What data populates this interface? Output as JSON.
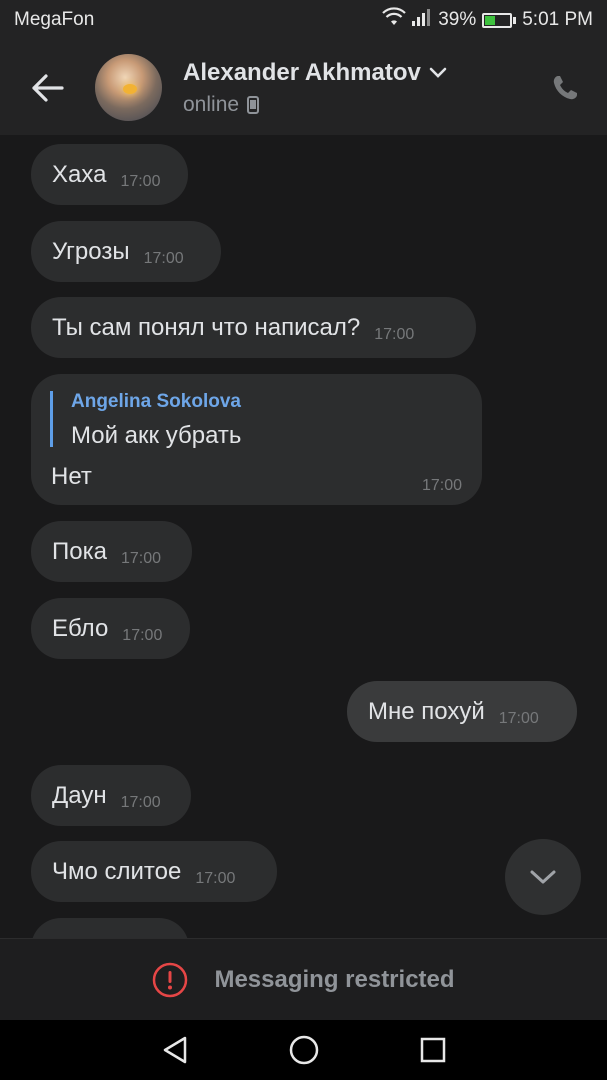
{
  "status_bar": {
    "carrier": "MegaFon",
    "battery": "39%",
    "battery_level": 0.39,
    "time": "5:01 PM"
  },
  "header": {
    "contact_name": "Alexander Akhmatov",
    "status": "online"
  },
  "messages": [
    {
      "text": "Хаха",
      "time": "17:00",
      "direction": "in"
    },
    {
      "text": "Угрозы",
      "time": "17:00",
      "direction": "in"
    },
    {
      "text": "Ты сам понял что написал?",
      "time": "17:00",
      "direction": "in"
    },
    {
      "text": "Нет",
      "time": "17:00",
      "direction": "in",
      "reply_to": {
        "author": "Angelina Sokolova",
        "text": "Мой акк убрать"
      }
    },
    {
      "text": "Пока",
      "time": "17:00",
      "direction": "in"
    },
    {
      "text": "Ебло",
      "time": "17:00",
      "direction": "in"
    },
    {
      "text": "Мне похуй",
      "time": "17:00",
      "direction": "out"
    },
    {
      "text": "Даун",
      "time": "17:00",
      "direction": "in"
    },
    {
      "text": "Чмо слитое",
      "time": "17:00",
      "direction": "in"
    }
  ],
  "footer": {
    "restricted_text": "Messaging restricted"
  },
  "colors": {
    "background": "#19191a",
    "header": "#232324",
    "bubble_in": "#2c2d2e",
    "bubble_out": "#3a3b3c",
    "accent_reply": "#6ea6e8",
    "alert": "#e64646"
  },
  "icons": {
    "back": "arrow-left-icon",
    "chevron": "chevron-down-icon",
    "device": "phone-device-icon",
    "call": "phone-call-icon",
    "scroll": "chevron-down-icon",
    "alert": "exclamation-circle-icon",
    "nav_back": "triangle-back-icon",
    "nav_home": "circle-home-icon",
    "nav_recents": "square-recents-icon"
  }
}
